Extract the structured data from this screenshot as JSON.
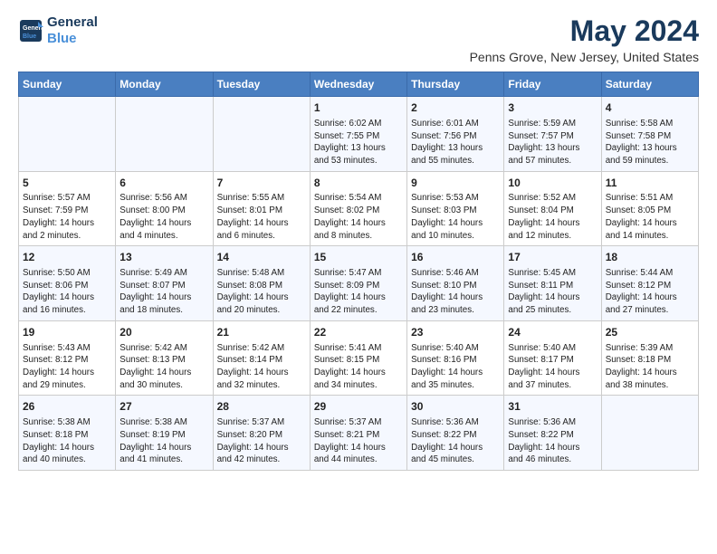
{
  "header": {
    "logo_line1": "General",
    "logo_line2": "Blue",
    "title": "May 2024",
    "subtitle": "Penns Grove, New Jersey, United States"
  },
  "days_of_week": [
    "Sunday",
    "Monday",
    "Tuesday",
    "Wednesday",
    "Thursday",
    "Friday",
    "Saturday"
  ],
  "weeks": [
    [
      {
        "day": "",
        "info": ""
      },
      {
        "day": "",
        "info": ""
      },
      {
        "day": "",
        "info": ""
      },
      {
        "day": "1",
        "info": "Sunrise: 6:02 AM\nSunset: 7:55 PM\nDaylight: 13 hours\nand 53 minutes."
      },
      {
        "day": "2",
        "info": "Sunrise: 6:01 AM\nSunset: 7:56 PM\nDaylight: 13 hours\nand 55 minutes."
      },
      {
        "day": "3",
        "info": "Sunrise: 5:59 AM\nSunset: 7:57 PM\nDaylight: 13 hours\nand 57 minutes."
      },
      {
        "day": "4",
        "info": "Sunrise: 5:58 AM\nSunset: 7:58 PM\nDaylight: 13 hours\nand 59 minutes."
      }
    ],
    [
      {
        "day": "5",
        "info": "Sunrise: 5:57 AM\nSunset: 7:59 PM\nDaylight: 14 hours\nand 2 minutes."
      },
      {
        "day": "6",
        "info": "Sunrise: 5:56 AM\nSunset: 8:00 PM\nDaylight: 14 hours\nand 4 minutes."
      },
      {
        "day": "7",
        "info": "Sunrise: 5:55 AM\nSunset: 8:01 PM\nDaylight: 14 hours\nand 6 minutes."
      },
      {
        "day": "8",
        "info": "Sunrise: 5:54 AM\nSunset: 8:02 PM\nDaylight: 14 hours\nand 8 minutes."
      },
      {
        "day": "9",
        "info": "Sunrise: 5:53 AM\nSunset: 8:03 PM\nDaylight: 14 hours\nand 10 minutes."
      },
      {
        "day": "10",
        "info": "Sunrise: 5:52 AM\nSunset: 8:04 PM\nDaylight: 14 hours\nand 12 minutes."
      },
      {
        "day": "11",
        "info": "Sunrise: 5:51 AM\nSunset: 8:05 PM\nDaylight: 14 hours\nand 14 minutes."
      }
    ],
    [
      {
        "day": "12",
        "info": "Sunrise: 5:50 AM\nSunset: 8:06 PM\nDaylight: 14 hours\nand 16 minutes."
      },
      {
        "day": "13",
        "info": "Sunrise: 5:49 AM\nSunset: 8:07 PM\nDaylight: 14 hours\nand 18 minutes."
      },
      {
        "day": "14",
        "info": "Sunrise: 5:48 AM\nSunset: 8:08 PM\nDaylight: 14 hours\nand 20 minutes."
      },
      {
        "day": "15",
        "info": "Sunrise: 5:47 AM\nSunset: 8:09 PM\nDaylight: 14 hours\nand 22 minutes."
      },
      {
        "day": "16",
        "info": "Sunrise: 5:46 AM\nSunset: 8:10 PM\nDaylight: 14 hours\nand 23 minutes."
      },
      {
        "day": "17",
        "info": "Sunrise: 5:45 AM\nSunset: 8:11 PM\nDaylight: 14 hours\nand 25 minutes."
      },
      {
        "day": "18",
        "info": "Sunrise: 5:44 AM\nSunset: 8:12 PM\nDaylight: 14 hours\nand 27 minutes."
      }
    ],
    [
      {
        "day": "19",
        "info": "Sunrise: 5:43 AM\nSunset: 8:12 PM\nDaylight: 14 hours\nand 29 minutes."
      },
      {
        "day": "20",
        "info": "Sunrise: 5:42 AM\nSunset: 8:13 PM\nDaylight: 14 hours\nand 30 minutes."
      },
      {
        "day": "21",
        "info": "Sunrise: 5:42 AM\nSunset: 8:14 PM\nDaylight: 14 hours\nand 32 minutes."
      },
      {
        "day": "22",
        "info": "Sunrise: 5:41 AM\nSunset: 8:15 PM\nDaylight: 14 hours\nand 34 minutes."
      },
      {
        "day": "23",
        "info": "Sunrise: 5:40 AM\nSunset: 8:16 PM\nDaylight: 14 hours\nand 35 minutes."
      },
      {
        "day": "24",
        "info": "Sunrise: 5:40 AM\nSunset: 8:17 PM\nDaylight: 14 hours\nand 37 minutes."
      },
      {
        "day": "25",
        "info": "Sunrise: 5:39 AM\nSunset: 8:18 PM\nDaylight: 14 hours\nand 38 minutes."
      }
    ],
    [
      {
        "day": "26",
        "info": "Sunrise: 5:38 AM\nSunset: 8:18 PM\nDaylight: 14 hours\nand 40 minutes."
      },
      {
        "day": "27",
        "info": "Sunrise: 5:38 AM\nSunset: 8:19 PM\nDaylight: 14 hours\nand 41 minutes."
      },
      {
        "day": "28",
        "info": "Sunrise: 5:37 AM\nSunset: 8:20 PM\nDaylight: 14 hours\nand 42 minutes."
      },
      {
        "day": "29",
        "info": "Sunrise: 5:37 AM\nSunset: 8:21 PM\nDaylight: 14 hours\nand 44 minutes."
      },
      {
        "day": "30",
        "info": "Sunrise: 5:36 AM\nSunset: 8:22 PM\nDaylight: 14 hours\nand 45 minutes."
      },
      {
        "day": "31",
        "info": "Sunrise: 5:36 AM\nSunset: 8:22 PM\nDaylight: 14 hours\nand 46 minutes."
      },
      {
        "day": "",
        "info": ""
      }
    ]
  ]
}
